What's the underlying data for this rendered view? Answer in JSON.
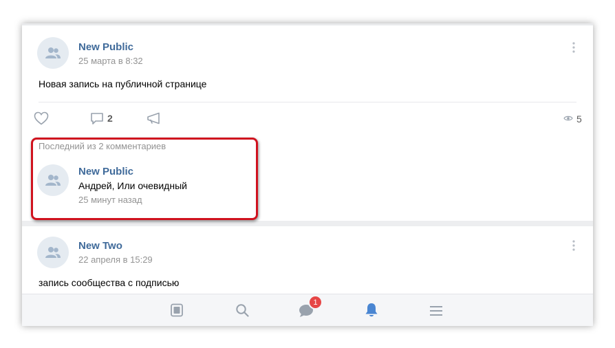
{
  "post1": {
    "author": "New Public",
    "date": "25 марта в 8:32",
    "text": "Новая запись на публичной странице",
    "comments_count": "2",
    "views_count": "5"
  },
  "comments_block": {
    "header": "Последний из 2 комментариев",
    "author": "New Public",
    "text": "Андрей, Или очевидный",
    "time": "25 минут назад"
  },
  "post2": {
    "author": "New Two",
    "date": "22 апреля в 15:29",
    "text": "запись сообщества с подписью"
  },
  "tabbar": {
    "messages_badge": "1",
    "items": [
      "news-icon",
      "search-icon",
      "messages-icon",
      "notifications-icon",
      "menu-icon"
    ],
    "active": "notifications-icon"
  },
  "colors": {
    "link": "#3f6a9a",
    "secondary_text": "#939393",
    "active_tab": "#4a86d2",
    "highlight": "#d0121e",
    "badge": "#e64646"
  }
}
